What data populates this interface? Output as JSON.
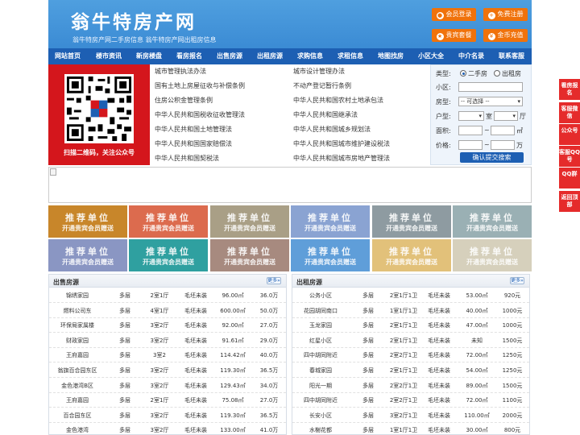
{
  "header": {
    "title": "翁牛特房产网",
    "subtitle": "翁牛特房产网二手房信息   翁牛特房产网出租房信息",
    "buttons": [
      {
        "label": "会员登录",
        "icon": "user-icon"
      },
      {
        "label": "免费注册",
        "icon": "register-icon"
      },
      {
        "label": "贵宾套餐",
        "icon": "vip-icon"
      },
      {
        "label": "金币充值",
        "icon": "coin-icon"
      }
    ]
  },
  "nav": [
    "网站首页",
    "楼市资讯",
    "新房楼盘",
    "看房报名",
    "出售房源",
    "出租房源",
    "求购信息",
    "求租信息",
    "地图找房",
    "小区大全",
    "中介名录",
    "联系客服"
  ],
  "qr": {
    "caption": "扫描二维码，关注公众号"
  },
  "links": {
    "left": [
      "城市管理执法办法",
      "国有土地上房屋征收与补偿条例",
      "住房公积金管理条例",
      "中华人民共和国税收征收管理法",
      "中华人民共和国土地管理法",
      "中华人民共和国国家赔偿法",
      "中华人民共和国契税法"
    ],
    "right": [
      "城市设计管理办法",
      "不动产登记暂行条例",
      "中华人民共和国农村土地承包法",
      "中华人民共和国继承法",
      "中华人民共和国城乡规划法",
      "中华人民共和国城市维护建设税法",
      "中华人民共和国城市房地产管理法"
    ]
  },
  "search": {
    "type_label": "类型:",
    "type_options": [
      "二手房",
      "出租房"
    ],
    "community_label": "小区:",
    "house_type_label": "房型:",
    "house_type_value": "-- 可选择 --",
    "layout_label": "户型:",
    "room_unit": "室",
    "hall_unit": "厅",
    "area_label": "面积:",
    "area_unit": "㎡",
    "price_label": "价格:",
    "price_unit": "万",
    "range_sep": "~",
    "submit": "确认提交搜索"
  },
  "tiles": {
    "line1": "推荐单位",
    "line2": "开通贵宾会员赠送",
    "colors": [
      "#c8862a",
      "#dc6b4e",
      "#a99f86",
      "#8aa3d2",
      "#8e9ba1",
      "#9ab0b4",
      "#8a96c3",
      "#2fa0a0",
      "#a78a7f",
      "#5f9ed9",
      "#e2c17a",
      "#d6d0bc"
    ]
  },
  "sale": {
    "title": "出售房源",
    "more": "更多»",
    "rows": [
      [
        "锦绣家园",
        "多层",
        "2室1厅",
        "毛坯未装",
        "96.00㎡",
        "36.0万"
      ],
      [
        "燃料公司东",
        "多层",
        "4室1厅",
        "毛坯未装",
        "600.00㎡",
        "50.0万"
      ],
      [
        "环保局家属楼",
        "多层",
        "3室2厅",
        "毛坯未装",
        "92.00㎡",
        "27.0万"
      ],
      [
        "财政家园",
        "多层",
        "3室2厅",
        "毛坯未装",
        "91.61㎡",
        "29.0万"
      ],
      [
        "王府嘉园",
        "多层",
        "3室2",
        "毛坯未装",
        "114.42㎡",
        "40.0万"
      ],
      [
        "翁旗百合园东区",
        "多层",
        "3室2厅",
        "毛坯未装",
        "119.30㎡",
        "36.5万"
      ],
      [
        "金色港湾B区",
        "多层",
        "3室2厅",
        "毛坯未装",
        "129.43㎡",
        "34.0万"
      ],
      [
        "王府嘉园",
        "多层",
        "2室1厅",
        "毛坯未装",
        "75.08㎡",
        "27.0万"
      ],
      [
        "百合园东区",
        "多层",
        "3室2厅",
        "毛坯未装",
        "119.30㎡",
        "36.5万"
      ],
      [
        "金色港湾",
        "多层",
        "3室2厅",
        "毛坯未装",
        "133.00㎡",
        "41.0万"
      ]
    ]
  },
  "rent": {
    "title": "出租房源",
    "more": "更多»",
    "rows": [
      [
        "公务小区",
        "多层",
        "2室1厅1卫",
        "毛坯未装",
        "53.00㎡",
        "920元"
      ],
      [
        "花园胡同南口",
        "多层",
        "1室1厅1卫",
        "毛坯未装",
        "40.00㎡",
        "1000元"
      ],
      [
        "玉龙家园",
        "多层",
        "2室1厅1卫",
        "毛坯未装",
        "47.00㎡",
        "1000元"
      ],
      [
        "红星小区",
        "多层",
        "2室1厅1卫",
        "毛坯未装",
        "未知",
        "1500元"
      ],
      [
        "四中胡同附近",
        "多层",
        "2室2厅1卫",
        "毛坯未装",
        "72.00㎡",
        "1250元"
      ],
      [
        "春城家园",
        "多层",
        "2室1厅1卫",
        "毛坯未装",
        "54.00㎡",
        "1250元"
      ],
      [
        "阳光一期",
        "多层",
        "2室2厅1卫",
        "毛坯未装",
        "89.00㎡",
        "1500元"
      ],
      [
        "四中胡同附近",
        "多层",
        "2室2厅1卫",
        "毛坯未装",
        "72.00㎡",
        "1100元"
      ],
      [
        "长安小区",
        "多层",
        "3室2厅1卫",
        "毛坯未装",
        "110.00㎡",
        "2000元"
      ],
      [
        "水榭花都",
        "多层",
        "1室1厅1卫",
        "毛坯未装",
        "30.00㎡",
        "800元"
      ]
    ]
  },
  "float": [
    "看房报名",
    "客服微信",
    "公众号",
    "客服QQ号",
    "QQ群",
    "返回顶部"
  ]
}
